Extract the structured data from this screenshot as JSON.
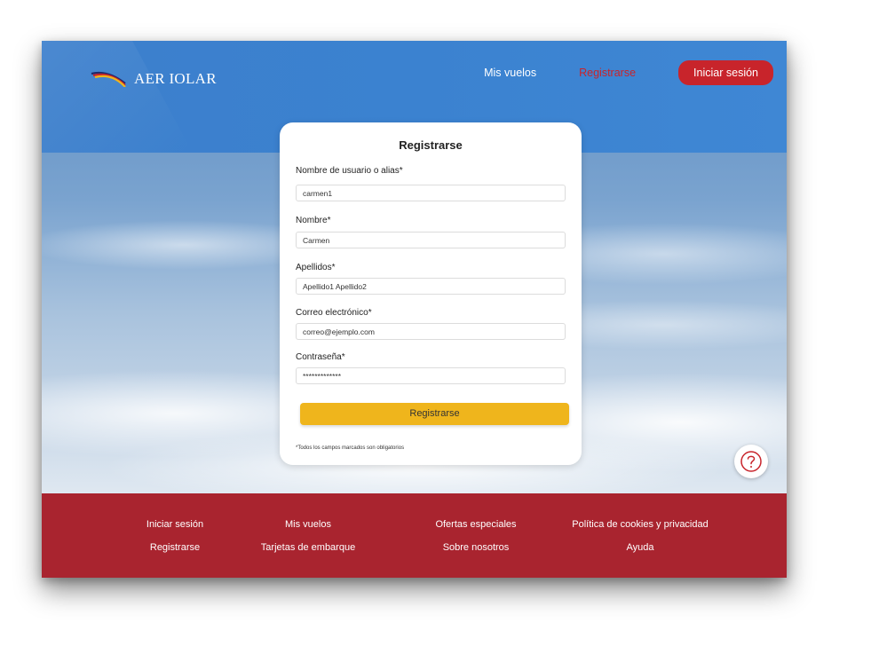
{
  "brand": {
    "name": "AER IOLAR"
  },
  "nav": {
    "my_flights": "Mis vuelos",
    "register": "Registrarse",
    "login": "Iniciar sesión"
  },
  "form": {
    "title": "Registrarse",
    "fields": [
      {
        "label": "Nombre de usuario o alias*",
        "value": "carmen1"
      },
      {
        "label": "Nombre*",
        "value": "Carmen"
      },
      {
        "label": "Apellidos*",
        "value": "Apellido1 Apellido2"
      },
      {
        "label": "Correo electrónico*",
        "value": "correo@ejemplo.com"
      },
      {
        "label": "Contraseña*",
        "value": "*************"
      }
    ],
    "submit_label": "Registrarse",
    "required_note": "*Todos los campos marcados son obligatorios"
  },
  "help": {
    "icon": "question-mark-icon"
  },
  "footer": {
    "links": [
      "Iniciar sesión",
      "Mis vuelos",
      "Ofertas especiales",
      "Política de cookies y privacidad",
      "Registrarse",
      "Tarjetas de embarque",
      "Sobre nosotros",
      "Ayuda"
    ]
  },
  "colors": {
    "header_blue": "#3b82d0",
    "accent_red": "#c8242b",
    "footer_red": "#a9242f",
    "button_yellow": "#efb51c"
  }
}
